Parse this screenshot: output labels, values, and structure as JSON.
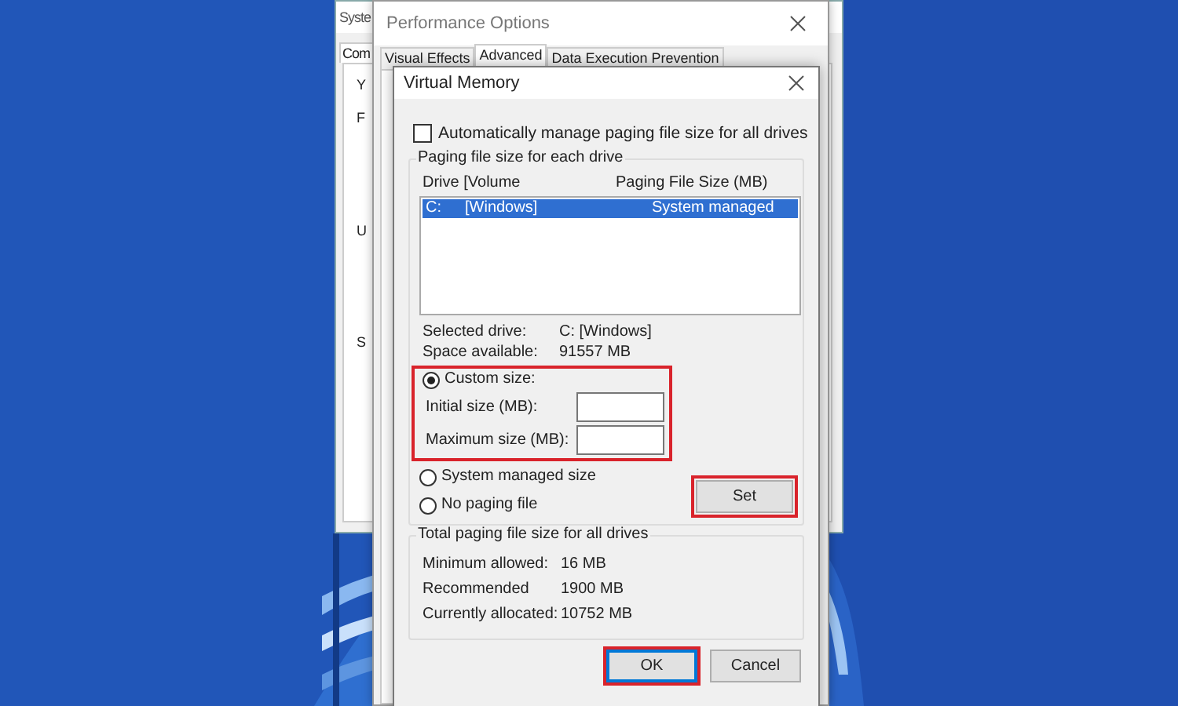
{
  "system_window": {
    "title": "Syste",
    "tab": "Com",
    "cut_labels": [
      "Y",
      "F",
      "U",
      "S"
    ]
  },
  "performance_options": {
    "title": "Performance Options",
    "tabs": [
      {
        "label": "Visual Effects",
        "selected": false
      },
      {
        "label": "Advanced",
        "selected": true
      },
      {
        "label": "Data Execution Prevention",
        "selected": false
      }
    ]
  },
  "virtual_memory": {
    "title": "Virtual Memory",
    "auto_manage": {
      "label": "Automatically manage paging file size for all drives",
      "checked": false
    },
    "drives_group": {
      "title": "Paging file size for each drive",
      "columns": [
        "Drive  [Volume",
        "Paging File Size (MB)"
      ],
      "rows": [
        {
          "drive": "C:",
          "volume": "[Windows]",
          "size": "System managed",
          "selected": true
        }
      ],
      "selected_drive": {
        "label": "Selected drive:",
        "value": "C:  [Windows]"
      },
      "space_available": {
        "label": "Space available:",
        "value": "91557 MB"
      },
      "size_options": [
        {
          "kind": "custom",
          "label": "Custom size:",
          "selected": true,
          "highlighted": true,
          "fields": [
            {
              "label": "Initial size (MB):"
            },
            {
              "label": "Maximum size (MB):"
            }
          ]
        },
        {
          "kind": "plain",
          "label": "System managed size",
          "selected": false
        },
        {
          "kind": "plain",
          "label": "No paging file",
          "selected": false
        }
      ],
      "set_button": {
        "label": "Set",
        "highlighted": true
      }
    },
    "totals_group": {
      "title": "Total paging file size for all drives",
      "rows": [
        {
          "label": "Minimum allowed:",
          "value": "16 MB"
        },
        {
          "label": "Recommended",
          "value": "1900 MB"
        },
        {
          "label": "Currently allocated:",
          "value": "10752 MB"
        }
      ]
    },
    "buttons": [
      {
        "label": "OK",
        "default": true,
        "highlighted": true
      },
      {
        "label": "Cancel",
        "default": false,
        "highlighted": false
      }
    ]
  }
}
